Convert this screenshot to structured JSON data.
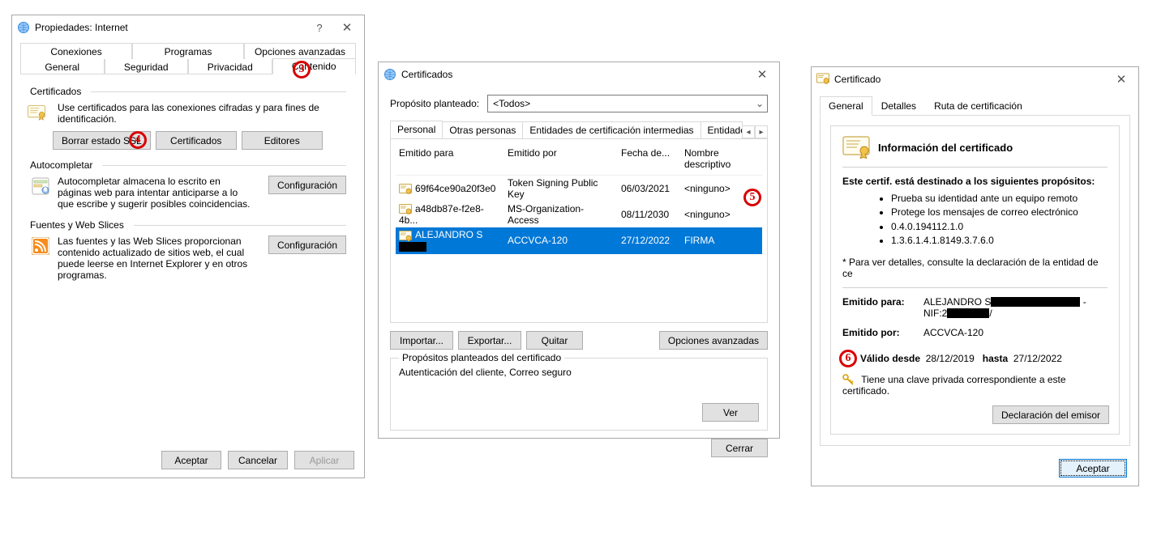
{
  "win1": {
    "title": "Propiedades: Internet",
    "tabs_top": [
      "Conexiones",
      "Programas",
      "Opciones avanzadas"
    ],
    "tabs_bottom": [
      "General",
      "Seguridad",
      "Privacidad",
      "Contenido"
    ],
    "active_tab": "Contenido",
    "certs": {
      "header": "Certificados",
      "desc": "Use certificados para las conexiones cifradas y para fines de identificación.",
      "btn_clear": "Borrar estado SSL",
      "btn_certs": "Certificados",
      "btn_publishers": "Editores"
    },
    "auto": {
      "header": "Autocompletar",
      "desc": "Autocompletar almacena lo escrito en páginas web para intentar anticiparse a lo que escribe y sugerir posibles coincidencias.",
      "btn": "Configuración"
    },
    "feeds": {
      "header": "Fuentes y Web Slices",
      "desc": "Las fuentes y las Web Slices proporcionan contenido actualizado de sitios web, el cual puede leerse en Internet Explorer y en otros programas.",
      "btn": "Configuración"
    },
    "footer": {
      "ok": "Aceptar",
      "cancel": "Cancelar",
      "apply": "Aplicar"
    }
  },
  "win2": {
    "title": "Certificados",
    "purpose_label": "Propósito planteado:",
    "purpose_value": "<Todos>",
    "tabs": [
      "Personal",
      "Otras personas",
      "Entidades de certificación intermedias",
      "Entidades de certificaci"
    ],
    "cols": {
      "c1": "Emitido para",
      "c2": "Emitido por",
      "c3": "Fecha de...",
      "c4": "Nombre descriptivo"
    },
    "rows": [
      {
        "c1": "69f64ce90a20f3e0",
        "c2": "Token Signing Public Key",
        "c3": "06/03/2021",
        "c4": "<ninguno>"
      },
      {
        "c1": "a48db87e-f2e8-4b...",
        "c2": "MS-Organization-Access",
        "c3": "08/11/2030",
        "c4": "<ninguno>"
      },
      {
        "c1": "ALEJANDRO S",
        "c2": "ACCVCA-120",
        "c3": "27/12/2022",
        "c4": "FIRMA",
        "sel": true,
        "redact": true
      }
    ],
    "btns": {
      "import": "Importar...",
      "export": "Exportar...",
      "remove": "Quitar",
      "advanced": "Opciones avanzadas"
    },
    "fieldset": {
      "legend": "Propósitos planteados del certificado",
      "text": "Autenticación del cliente, Correo seguro",
      "view": "Ver"
    },
    "close": "Cerrar"
  },
  "win3": {
    "title": "Certificado",
    "tabs": [
      "General",
      "Detalles",
      "Ruta de certificación"
    ],
    "info_title": "Información del certificado",
    "dest_label": "Este certif. está destinado a los siguientes propósitos:",
    "bullets": [
      "Prueba su identidad ante un equipo remoto",
      "Protege los mensajes de correo electrónico",
      "0.4.0.194112.1.0",
      "1.3.6.1.4.1.8149.3.7.6.0"
    ],
    "note": "* Para ver detalles, consulte la declaración de la entidad de ce",
    "issued_to_label": "Emitido para:",
    "issued_to_value": "ALEJANDRO S",
    "issued_to_line2_prefix": "NIF:2",
    "issued_by_label": "Emitido por:",
    "issued_by_value": "ACCVCA-120",
    "valid_from_label": "Válido desde",
    "valid_from": "28/12/2019",
    "valid_to_label": "hasta",
    "valid_to": "27/12/2022",
    "private_key": "Tiene una clave privada correspondiente a este certificado.",
    "issuer_stmt": "Declaración del emisor",
    "ok": "Aceptar"
  },
  "callouts": {
    "c3": "3",
    "c4": "4",
    "c5": "5",
    "c6": "6"
  }
}
